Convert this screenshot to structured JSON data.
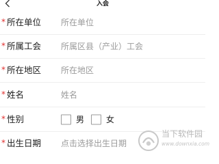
{
  "header": {
    "back_icon": "chevron-left-icon",
    "title": "入会"
  },
  "form": {
    "required_mark": "*",
    "unit": {
      "label": "所在单位",
      "placeholder": "所在单位"
    },
    "union": {
      "label": "所属工会",
      "placeholder": "所属区县（产业）工会"
    },
    "region": {
      "label": "所在地区",
      "placeholder": "所在地区"
    },
    "name": {
      "label": "姓名",
      "placeholder": "姓名"
    },
    "gender": {
      "label": "性别",
      "options": [
        {
          "label": "男",
          "checked": false
        },
        {
          "label": "女",
          "checked": false
        }
      ]
    },
    "birthdate": {
      "label": "出生日期",
      "placeholder": "点击选择出生日期"
    }
  },
  "colors": {
    "required": "#e0302f",
    "placeholder": "#9a9a9a",
    "divider": "#eeeeee"
  },
  "watermark": {
    "text": "当下软件园",
    "url": "www.downxia.com"
  }
}
